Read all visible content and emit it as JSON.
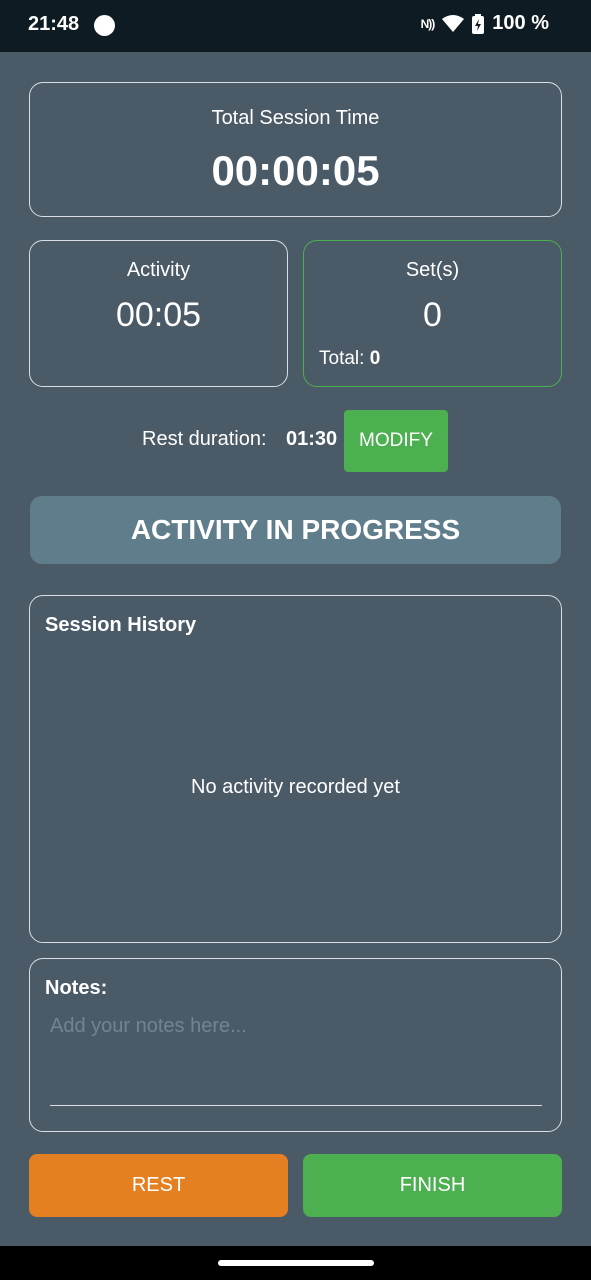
{
  "status_bar": {
    "time": "21:48",
    "nfc": "N))",
    "battery_percent": "100 %",
    "icons": [
      "notification-dot-icon",
      "nfc-icon",
      "wifi-icon",
      "battery-charging-icon"
    ]
  },
  "session": {
    "total_label": "Total Session Time",
    "total_value": "00:00:05"
  },
  "activity": {
    "label": "Activity",
    "value": "00:05"
  },
  "sets": {
    "label": "Set(s)",
    "value": "0",
    "total_label": "Total:",
    "total_value": "0"
  },
  "rest": {
    "label": "Rest duration:",
    "value": "01:30",
    "modify_label": "MODIFY"
  },
  "banner": {
    "text": "ACTIVITY IN PROGRESS"
  },
  "history": {
    "title": "Session History",
    "empty_text": "No activity recorded yet"
  },
  "notes": {
    "title": "Notes:",
    "placeholder": "Add your notes here...",
    "value": ""
  },
  "actions": {
    "rest_label": "REST",
    "finish_label": "FINISH"
  },
  "colors": {
    "background": "#4a5a66",
    "accent_green": "#4caf50",
    "accent_orange": "#e47f22",
    "banner": "#607d8b",
    "status_bar": "#0f1b22"
  }
}
